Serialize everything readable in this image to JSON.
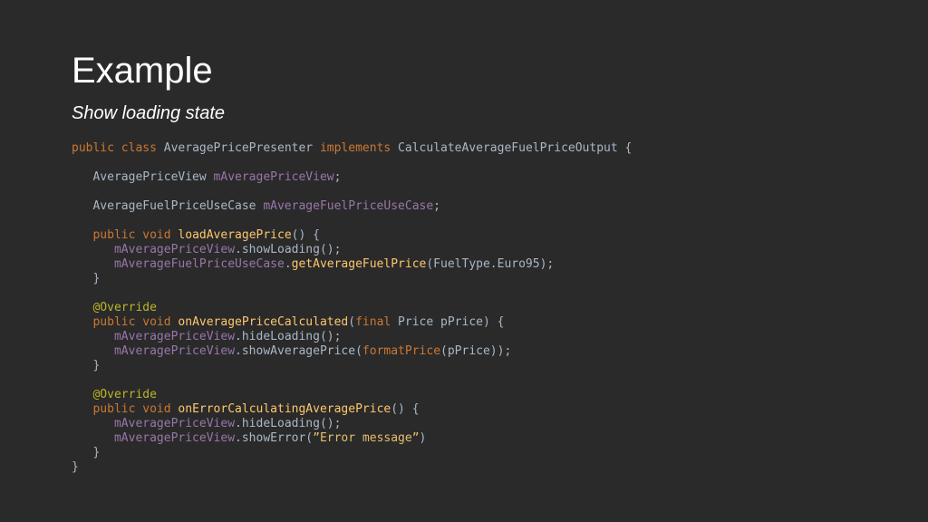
{
  "slide": {
    "title": "Example",
    "subtitle": "Show loading state"
  },
  "colors": {
    "background": "#2a2a2a",
    "text": "#ffffff",
    "code_plain": "#a9b7c6",
    "keyword": "#cc7832",
    "method": "#ffc66d",
    "field": "#9876aa",
    "annotation": "#bbb529",
    "string": "#e8bf6a"
  },
  "code": {
    "lines": [
      [
        [
          "kw",
          "public"
        ],
        [
          "p",
          " "
        ],
        [
          "kw",
          "class"
        ],
        [
          "p",
          " AveragePricePresenter "
        ],
        [
          "kw",
          "implements"
        ],
        [
          "p",
          " CalculateAverageFuelPriceOutput {"
        ]
      ],
      [],
      [
        [
          "p",
          "   AveragePriceView "
        ],
        [
          "field",
          "mAveragePriceView"
        ],
        [
          "p",
          ";"
        ]
      ],
      [],
      [
        [
          "p",
          "   AverageFuelPriceUseCase "
        ],
        [
          "field",
          "mAverageFuelPriceUseCase"
        ],
        [
          "p",
          ";"
        ]
      ],
      [],
      [
        [
          "p",
          "   "
        ],
        [
          "kw",
          "public"
        ],
        [
          "p",
          " "
        ],
        [
          "kw",
          "void"
        ],
        [
          "p",
          " "
        ],
        [
          "fn",
          "loadAveragePrice"
        ],
        [
          "p",
          "() {"
        ]
      ],
      [
        [
          "p",
          "      "
        ],
        [
          "field",
          "mAveragePriceView"
        ],
        [
          "p",
          ".showLoading();"
        ]
      ],
      [
        [
          "p",
          "      "
        ],
        [
          "field",
          "mAverageFuelPriceUseCase"
        ],
        [
          "p",
          "."
        ],
        [
          "fn",
          "getAverageFuelPrice"
        ],
        [
          "p",
          "(FuelType.Euro95);"
        ]
      ],
      [
        [
          "p",
          "   }"
        ]
      ],
      [],
      [
        [
          "p",
          "   "
        ],
        [
          "ann",
          "@Override"
        ]
      ],
      [
        [
          "p",
          "   "
        ],
        [
          "kw",
          "public"
        ],
        [
          "p",
          " "
        ],
        [
          "kw",
          "void"
        ],
        [
          "p",
          " "
        ],
        [
          "fn",
          "onAveragePriceCalculated"
        ],
        [
          "p",
          "("
        ],
        [
          "kw",
          "final"
        ],
        [
          "p",
          " Price pPrice) {"
        ]
      ],
      [
        [
          "p",
          "      "
        ],
        [
          "field",
          "mAveragePriceView"
        ],
        [
          "p",
          ".hideLoading();"
        ]
      ],
      [
        [
          "p",
          "      "
        ],
        [
          "field",
          "mAveragePriceView"
        ],
        [
          "p",
          ".showAveragePrice("
        ],
        [
          "kw",
          "formatPrice"
        ],
        [
          "p",
          "(pPrice));"
        ]
      ],
      [
        [
          "p",
          "   }"
        ]
      ],
      [],
      [
        [
          "p",
          "   "
        ],
        [
          "ann",
          "@Override"
        ]
      ],
      [
        [
          "p",
          "   "
        ],
        [
          "kw",
          "public"
        ],
        [
          "p",
          " "
        ],
        [
          "kw",
          "void"
        ],
        [
          "p",
          " "
        ],
        [
          "fn",
          "onErrorCalculatingAveragePrice"
        ],
        [
          "p",
          "() {"
        ]
      ],
      [
        [
          "p",
          "      "
        ],
        [
          "field",
          "mAveragePriceView"
        ],
        [
          "p",
          ".hideLoading();"
        ]
      ],
      [
        [
          "p",
          "      "
        ],
        [
          "field",
          "mAveragePriceView"
        ],
        [
          "p",
          ".showError("
        ],
        [
          "str",
          "”Error message”"
        ],
        [
          "p",
          ")"
        ]
      ],
      [
        [
          "p",
          "   }"
        ]
      ],
      [
        [
          "p",
          "}"
        ]
      ]
    ]
  }
}
